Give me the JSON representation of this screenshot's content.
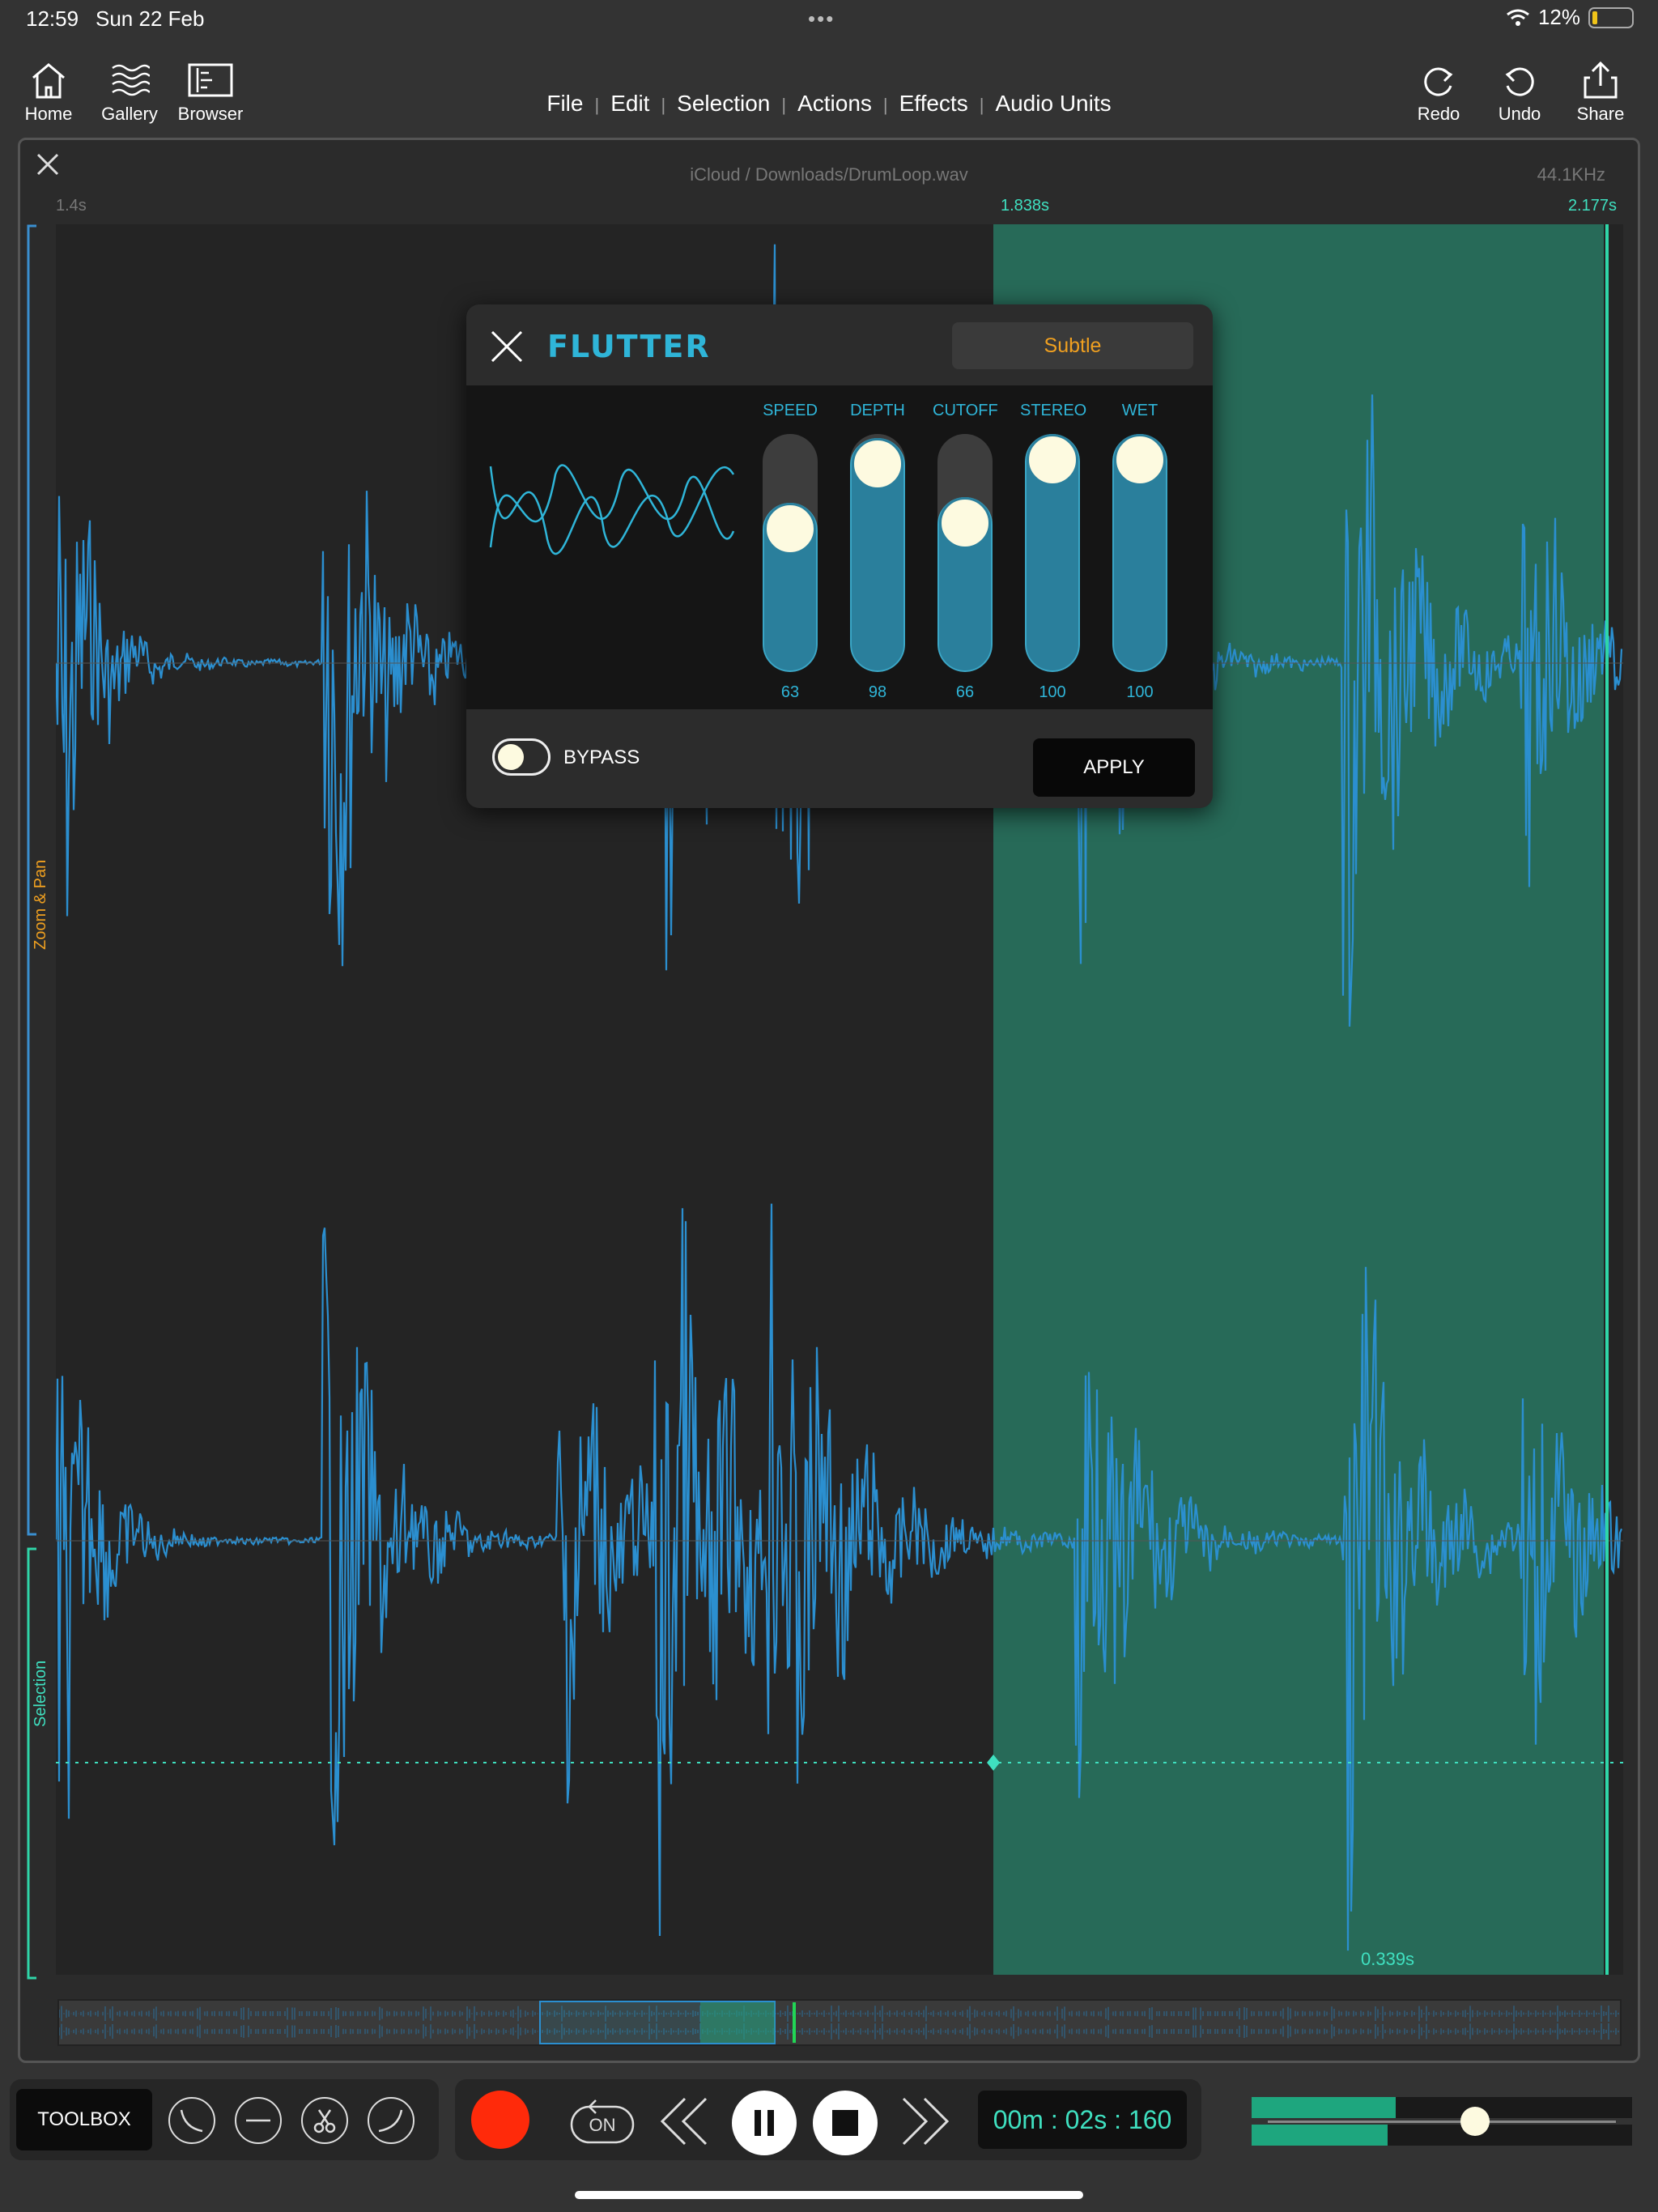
{
  "status": {
    "time": "12:59",
    "date": "Sun 22 Feb",
    "battery": "12%",
    "battery_level": 0.12
  },
  "toolbar": {
    "home": "Home",
    "gallery": "Gallery",
    "browser": "Browser",
    "redo": "Redo",
    "undo": "Undo",
    "share": "Share"
  },
  "menu": {
    "items": [
      "File",
      "Edit",
      "Selection",
      "Actions",
      "Effects",
      "Audio Units"
    ]
  },
  "editor": {
    "file_path": "iCloud / Downloads/DrumLoop.wav",
    "sample_rate": "44.1KHz",
    "ruler_start": "1.4s",
    "selection_start": "1.838s",
    "ruler_end": "2.177s",
    "selection_duration": "0.339s",
    "side_zoom": "Zoom & Pan",
    "side_selection": "Selection"
  },
  "effect": {
    "title": "FLUTTER",
    "preset": "Subtle",
    "params": [
      {
        "label": "SPEED",
        "value": "63",
        "level": 0.63
      },
      {
        "label": "DEPTH",
        "value": "98",
        "level": 0.98
      },
      {
        "label": "CUTOFF",
        "value": "66",
        "level": 0.66
      },
      {
        "label": "STEREO",
        "value": "100",
        "level": 1.0
      },
      {
        "label": "WET",
        "value": "100",
        "level": 1.0
      }
    ],
    "bypass_label": "BYPASS",
    "apply_label": "APPLY"
  },
  "transport": {
    "toolbox": "TOOLBOX",
    "loop": "ON",
    "time": "00m : 02s : 160"
  },
  "colors": {
    "accent": "#2fb5d8",
    "selection": "#276a58",
    "record": "#ff2a0a",
    "preset": "#f0a020"
  }
}
